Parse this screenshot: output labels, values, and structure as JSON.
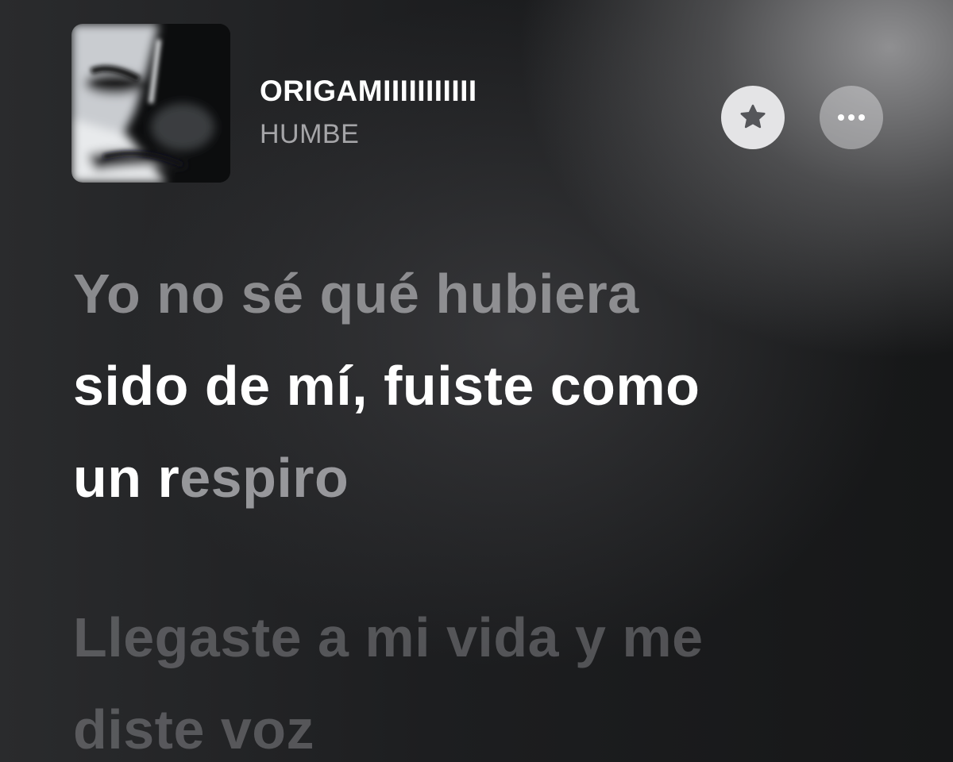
{
  "now_playing": {
    "title": "ORIGAMIIIIIIIIIII",
    "artist": "HUMBE",
    "artwork_icon": "album-artwork-face"
  },
  "controls": {
    "favorite_icon": "star-icon",
    "more_icon": "ellipsis-icon"
  },
  "lyrics": {
    "current_stanza": {
      "line1": "Yo no sé qué hubiera",
      "line2": "sido de mí, fuiste como",
      "line3_sung": "un r",
      "line3_unsung": "espiro"
    },
    "next_stanza": {
      "line1": "Llegaste a mi vida y me",
      "line2": "diste voz"
    }
  },
  "colors": {
    "background": "#1b1c1e",
    "active_text": "#ffffff",
    "favorite_button": "#e4e4e6"
  }
}
